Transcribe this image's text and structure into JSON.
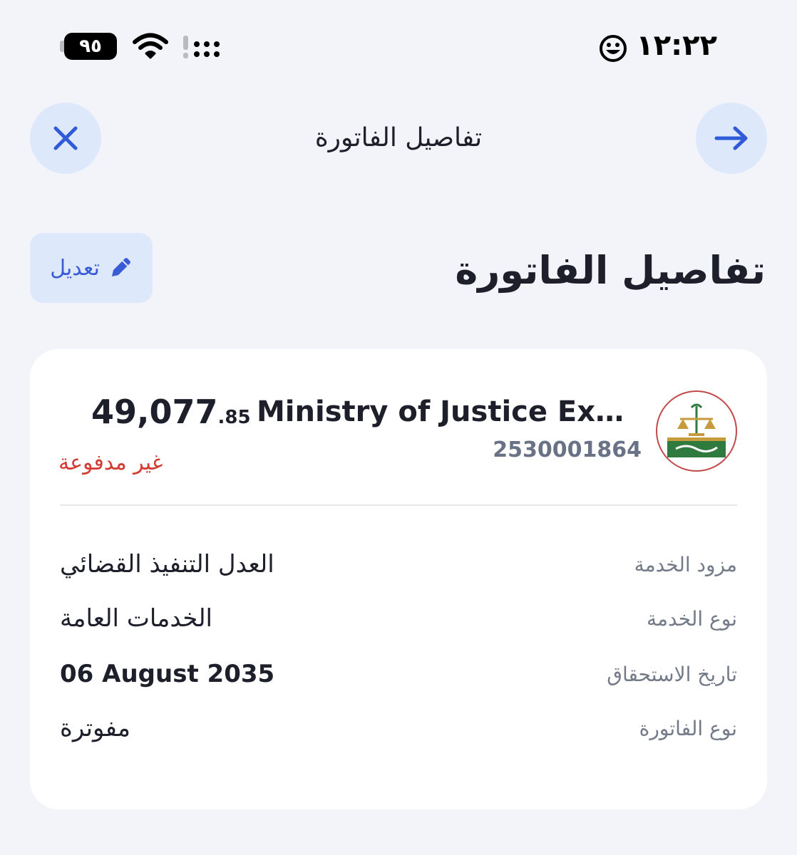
{
  "status_bar": {
    "time": "١٢:٢٢",
    "battery": "٩٥",
    "icons": [
      "smiley-icon",
      "wifi-icon",
      "signal-icon"
    ]
  },
  "nav": {
    "title": "تفاصيل الفاتورة",
    "close_icon": "close-icon",
    "back_icon": "arrow-right-icon"
  },
  "header": {
    "title": "تفاصيل الفاتورة",
    "edit_label": "تعديل",
    "edit_icon": "pencil-icon"
  },
  "bill": {
    "provider_name": "Ministry of Justice Exec…",
    "bill_number": "2530001864",
    "amount_int": "49,077",
    "amount_dec": ".85",
    "status": "غير مدفوعة",
    "logo_icon": "ministry-of-justice-logo"
  },
  "details": [
    {
      "label": "مزود الخدمة",
      "value": "العدل التنفيذ القضائي"
    },
    {
      "label": "نوع الخدمة",
      "value": "الخدمات العامة"
    },
    {
      "label": "تاريخ الاستحقاق",
      "value": "06 August 2035"
    },
    {
      "label": "نوع الفاتورة",
      "value": "مفوترة"
    }
  ],
  "colors": {
    "accent": "#3a5bd6",
    "accent_bg": "#dde8fb",
    "unpaid": "#d33a31",
    "page_bg": "#f2f4f9"
  }
}
